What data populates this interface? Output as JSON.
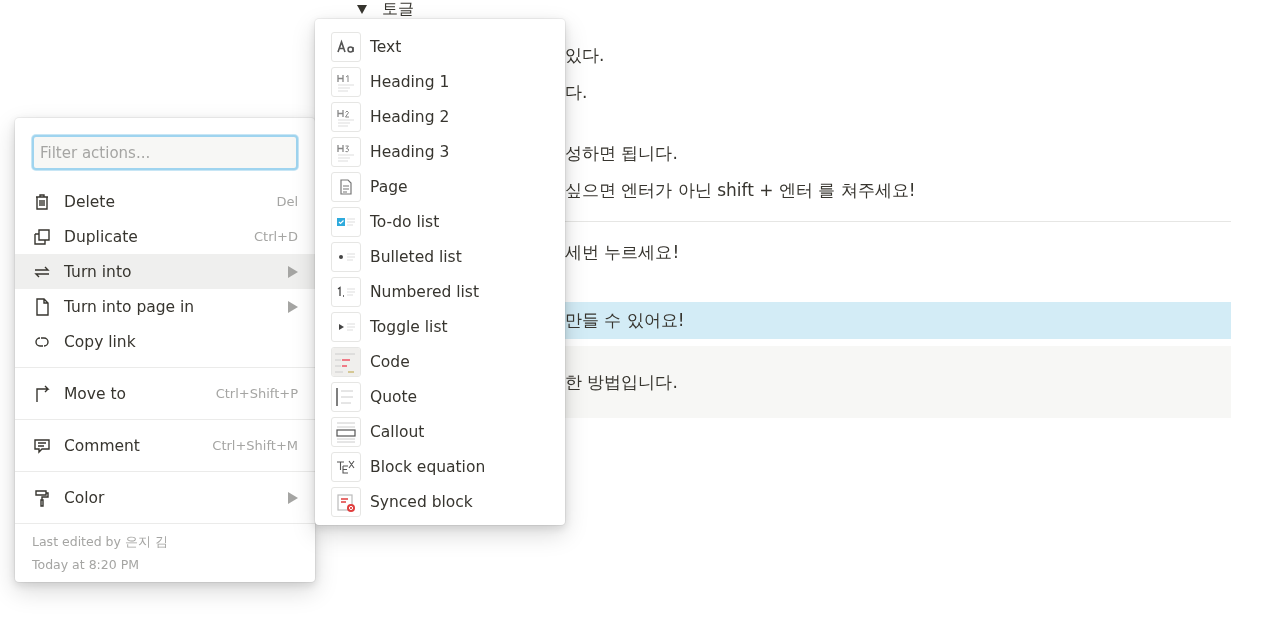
{
  "document": {
    "toggle": {
      "label": "토글",
      "expanded": true
    },
    "blocks": [
      {
        "kind": "text",
        "text": "있다."
      },
      {
        "kind": "text",
        "text": "다."
      },
      {
        "kind": "spacer"
      },
      {
        "kind": "text",
        "text": "성하면 됩니다."
      },
      {
        "kind": "text",
        "text": "싶으면 엔터가 아닌 shift + 엔터 를 쳐주세요!"
      },
      {
        "kind": "divider"
      },
      {
        "kind": "text",
        "text": "세번 누르세요!"
      },
      {
        "kind": "spacer"
      },
      {
        "kind": "callout",
        "text": "만들 수 있어요!"
      },
      {
        "kind": "box",
        "text": "한 방법입니다."
      }
    ]
  },
  "block_menu": {
    "filter": {
      "placeholder": "Filter actions..."
    },
    "sections": [
      [
        {
          "label": "Delete",
          "shortcut": "Del",
          "submenu": false,
          "selected": false
        },
        {
          "label": "Duplicate",
          "shortcut": "Ctrl+D",
          "submenu": false,
          "selected": false
        },
        {
          "label": "Turn into",
          "submenu": true,
          "selected": true
        },
        {
          "label": "Turn into page in",
          "submenu": true,
          "selected": false
        },
        {
          "label": "Copy link",
          "submenu": false,
          "selected": false
        }
      ],
      [
        {
          "label": "Move to",
          "shortcut": "Ctrl+Shift+P",
          "submenu": false,
          "selected": false
        }
      ],
      [
        {
          "label": "Comment",
          "shortcut": "Ctrl+Shift+M",
          "submenu": false,
          "selected": false
        }
      ],
      [
        {
          "label": "Color",
          "submenu": true,
          "selected": false
        }
      ]
    ],
    "footer": {
      "edited_by": "Last edited by 은지 김",
      "edited_at": "Today at 8:20 PM"
    }
  },
  "turn_into_menu": {
    "items": [
      {
        "label": "Text"
      },
      {
        "label": "Heading 1"
      },
      {
        "label": "Heading 2"
      },
      {
        "label": "Heading 3"
      },
      {
        "label": "Page"
      },
      {
        "label": "To-do list"
      },
      {
        "label": "Bulleted list"
      },
      {
        "label": "Numbered list"
      },
      {
        "label": "Toggle list"
      },
      {
        "label": "Code"
      },
      {
        "label": "Quote"
      },
      {
        "label": "Callout"
      },
      {
        "label": "Block equation"
      },
      {
        "label": "Synced block"
      }
    ]
  }
}
